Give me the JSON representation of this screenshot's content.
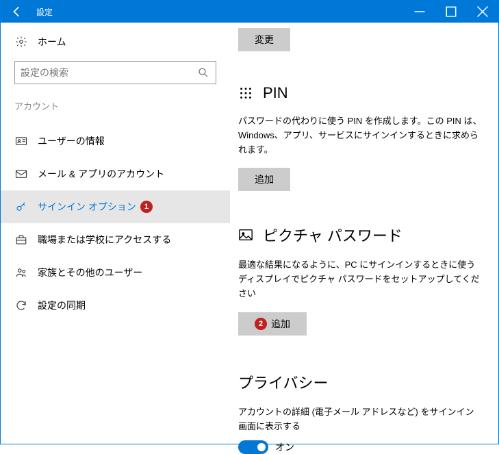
{
  "titlebar": {
    "title": "設定"
  },
  "sidebar": {
    "home": "ホーム",
    "search_placeholder": "設定の検索",
    "category": "アカウント",
    "items": [
      {
        "label": "ユーザーの情報"
      },
      {
        "label": "メール & アプリのアカウント"
      },
      {
        "label": "サインイン オプション",
        "badge": "1"
      },
      {
        "label": "職場または学校にアクセスする"
      },
      {
        "label": "家族とその他のユーザー"
      },
      {
        "label": "設定の同期"
      }
    ]
  },
  "main": {
    "change_btn": "変更",
    "pin": {
      "title": "PIN",
      "desc": "パスワードの代わりに使う PIN を作成します。この PIN は、Windows、アプリ、サービスにサインインするときに求められます。",
      "add_btn": "追加"
    },
    "picture": {
      "title": "ピクチャ パスワード",
      "desc": "最適な結果になるように、PC にサインインするときに使うディスプレイでピクチャ パスワードをセットアップしてください",
      "add_btn": "追加",
      "badge": "2"
    },
    "privacy": {
      "title": "プライバシー",
      "desc": "アカウントの詳細 (電子メール アドレスなど) をサインイン画面に表示する",
      "toggle_label": "オン"
    }
  }
}
